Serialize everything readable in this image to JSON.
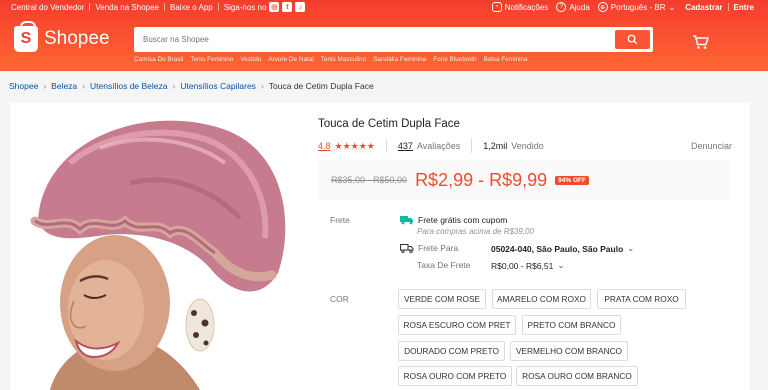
{
  "topbar": {
    "seller_center": "Central do Vendedor",
    "sell": "Venda na Shopee",
    "download_app": "Baixe o App",
    "follow_us": "Siga-nos no",
    "notifications": "Notificações",
    "help": "Ajuda",
    "language": "Português - BR",
    "register": "Cadastrar",
    "login": "Entre"
  },
  "brand": {
    "name": "Shopee",
    "color": "#f53d2d"
  },
  "search": {
    "placeholder": "Buscar na Shopee",
    "suggestions": [
      "Camisa Do Brasil",
      "Tenis Feminino",
      "Vestido",
      "Arvore De Natal",
      "Tenis Masculino",
      "Sandália Feminina",
      "Fone Bluetooth",
      "Bolsa Feminina"
    ]
  },
  "breadcrumb": [
    "Shopee",
    "Beleza",
    "Utensílios de Beleza",
    "Utensílios Capilares",
    "Touca de Cetim Dupla Face"
  ],
  "product": {
    "title": "Touca de Cetim Dupla Face",
    "rating": "4.8",
    "stars": 5,
    "reviews_count": "437",
    "reviews_label": "Avaliações",
    "sold_count": "1,2mil",
    "sold_label": "Vendido",
    "report": "Denunciar",
    "old_price": "R$35,00 - R$50,00",
    "price": "R$2,99 - R$9,99",
    "discount": "94% OFF",
    "accent_color": "#ee4d2d"
  },
  "shipping": {
    "label": "Frete",
    "free_title": "Frete grátis com cupom",
    "free_subtitle": "Para compras acima de R$39,00",
    "ship_to_label": "Frete Para",
    "ship_to_value": "05024-040, São Paulo, São Paulo",
    "fee_label": "Taxa De Frete",
    "fee_value": "R$0,00 - R$6,51"
  },
  "variations": {
    "label": "COR",
    "options": [
      "VERDE COM ROSE",
      "AMARELO COM ROXO",
      "PRATA COM ROXO",
      "ROSA ESCURO COM PRET",
      "PRETO COM BRANCO",
      "DOURADO COM PRETO",
      "VERMELHO COM BRANCO",
      "ROSA OURO COM PRETO",
      "ROSA OURO COM BRANCO"
    ]
  }
}
